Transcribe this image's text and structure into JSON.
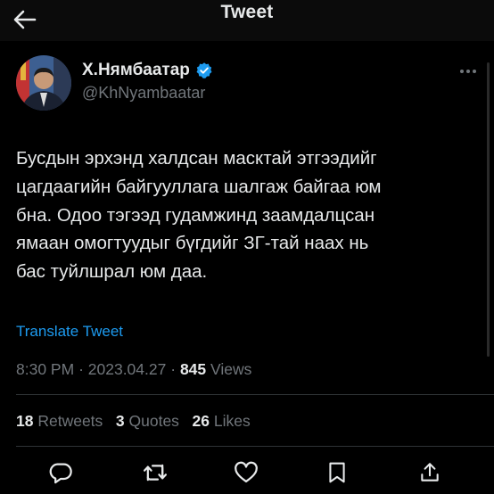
{
  "header": {
    "title": "Tweet"
  },
  "author": {
    "display_name": "Х.Нямбаатар",
    "handle": "@KhNyambaatar",
    "verified": true
  },
  "tweet": {
    "lines": [
      "Бусдын эрхэнд халдсан масктай этгээдийг",
      "цагдаагийн байгууллага шалгаж байгаа юм",
      "бна. Одоо тэгээд гудамжинд заамдалцсан",
      "ямаан омогтуудыг бүгдийг ЗГ-тай наах нь",
      "бас туйлшрал юм даа."
    ],
    "translate_label": "Translate Tweet",
    "time": "8:30 PM",
    "separator": "·",
    "date": "2023.04.27",
    "views_count": "845",
    "views_label": "Views"
  },
  "stats": {
    "retweets_count": "18",
    "retweets_label": "Retweets",
    "quotes_count": "3",
    "quotes_label": "Quotes",
    "likes_count": "26",
    "likes_label": "Likes"
  },
  "icons": {
    "back": "arrow-left-icon",
    "verified": "verified-badge-icon",
    "more": "more-dots-icon",
    "reply": "reply-icon",
    "retweet": "retweet-icon",
    "like": "heart-icon",
    "bookmark": "bookmark-icon",
    "share": "share-icon"
  },
  "colors": {
    "background": "#000000",
    "text": "#e7e9ea",
    "secondary": "#71767b",
    "accent": "#1d9bf0",
    "divider": "#2f3336"
  }
}
